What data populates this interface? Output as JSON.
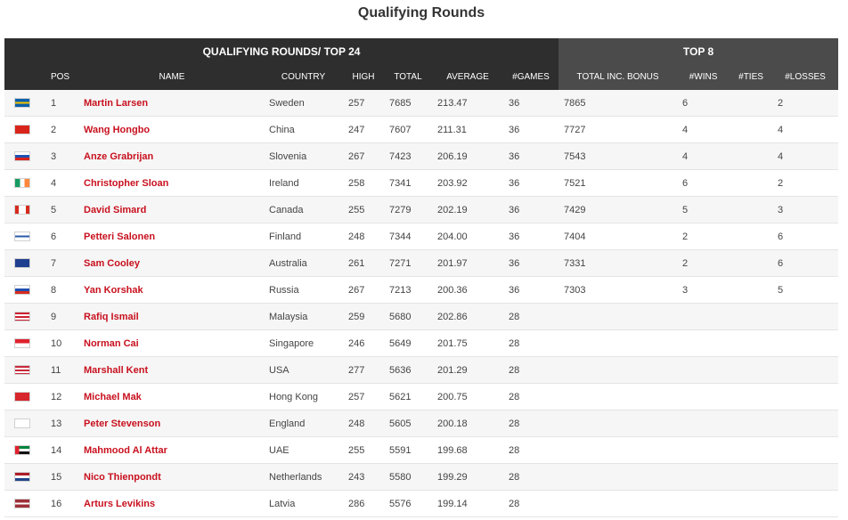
{
  "page_title": "Qualifying Rounds",
  "group_headers": {
    "qualifying": "QUALIFYING ROUNDS/ TOP 24",
    "top8": "TOP 8"
  },
  "columns": {
    "pos": "POS",
    "name": "NAME",
    "country": "COUNTRY",
    "high": "HIGH",
    "total": "TOTAL",
    "average": "AVERAGE",
    "games": "#GAMES",
    "total_inc_bonus": "TOTAL INC. BONUS",
    "wins": "#WINS",
    "ties": "#TIES",
    "losses": "#LOSSES"
  },
  "rows": [
    {
      "flag": "sweden",
      "pos": "1",
      "name": "Martin Larsen",
      "country": "Sweden",
      "high": "257",
      "total": "7685",
      "average": "213.47",
      "games": "36",
      "bonus": "7865",
      "wins": "6",
      "ties": "",
      "losses": "2"
    },
    {
      "flag": "china",
      "pos": "2",
      "name": "Wang Hongbo",
      "country": "China",
      "high": "247",
      "total": "7607",
      "average": "211.31",
      "games": "36",
      "bonus": "7727",
      "wins": "4",
      "ties": "",
      "losses": "4"
    },
    {
      "flag": "slovenia",
      "pos": "3",
      "name": "Anze Grabrijan",
      "country": "Slovenia",
      "high": "267",
      "total": "7423",
      "average": "206.19",
      "games": "36",
      "bonus": "7543",
      "wins": "4",
      "ties": "",
      "losses": "4"
    },
    {
      "flag": "ireland",
      "pos": "4",
      "name": "Christopher Sloan",
      "country": "Ireland",
      "high": "258",
      "total": "7341",
      "average": "203.92",
      "games": "36",
      "bonus": "7521",
      "wins": "6",
      "ties": "",
      "losses": "2"
    },
    {
      "flag": "canada",
      "pos": "5",
      "name": "David Simard",
      "country": "Canada",
      "high": "255",
      "total": "7279",
      "average": "202.19",
      "games": "36",
      "bonus": "7429",
      "wins": "5",
      "ties": "",
      "losses": "3"
    },
    {
      "flag": "finland",
      "pos": "6",
      "name": "Petteri Salonen",
      "country": "Finland",
      "high": "248",
      "total": "7344",
      "average": "204.00",
      "games": "36",
      "bonus": "7404",
      "wins": "2",
      "ties": "",
      "losses": "6"
    },
    {
      "flag": "australia",
      "pos": "7",
      "name": "Sam Cooley",
      "country": "Australia",
      "high": "261",
      "total": "7271",
      "average": "201.97",
      "games": "36",
      "bonus": "7331",
      "wins": "2",
      "ties": "",
      "losses": "6"
    },
    {
      "flag": "russia",
      "pos": "8",
      "name": "Yan Korshak",
      "country": "Russia",
      "high": "267",
      "total": "7213",
      "average": "200.36",
      "games": "36",
      "bonus": "7303",
      "wins": "3",
      "ties": "",
      "losses": "5"
    },
    {
      "flag": "malaysia",
      "pos": "9",
      "name": "Rafiq Ismail",
      "country": "Malaysia",
      "high": "259",
      "total": "5680",
      "average": "202.86",
      "games": "28",
      "bonus": "",
      "wins": "",
      "ties": "",
      "losses": ""
    },
    {
      "flag": "singapore",
      "pos": "10",
      "name": "Norman Cai",
      "country": "Singapore",
      "high": "246",
      "total": "5649",
      "average": "201.75",
      "games": "28",
      "bonus": "",
      "wins": "",
      "ties": "",
      "losses": ""
    },
    {
      "flag": "usa",
      "pos": "11",
      "name": "Marshall Kent",
      "country": "USA",
      "high": "277",
      "total": "5636",
      "average": "201.29",
      "games": "28",
      "bonus": "",
      "wins": "",
      "ties": "",
      "losses": ""
    },
    {
      "flag": "hongkong",
      "pos": "12",
      "name": "Michael Mak",
      "country": "Hong Kong",
      "high": "257",
      "total": "5621",
      "average": "200.75",
      "games": "28",
      "bonus": "",
      "wins": "",
      "ties": "",
      "losses": ""
    },
    {
      "flag": "england",
      "pos": "13",
      "name": "Peter Stevenson",
      "country": "England",
      "high": "248",
      "total": "5605",
      "average": "200.18",
      "games": "28",
      "bonus": "",
      "wins": "",
      "ties": "",
      "losses": ""
    },
    {
      "flag": "uae",
      "pos": "14",
      "name": "Mahmood Al Attar",
      "country": "UAE",
      "high": "255",
      "total": "5591",
      "average": "199.68",
      "games": "28",
      "bonus": "",
      "wins": "",
      "ties": "",
      "losses": ""
    },
    {
      "flag": "netherlands",
      "pos": "15",
      "name": "Nico Thienpondt",
      "country": "Netherlands",
      "high": "243",
      "total": "5580",
      "average": "199.29",
      "games": "28",
      "bonus": "",
      "wins": "",
      "ties": "",
      "losses": ""
    },
    {
      "flag": "latvia",
      "pos": "16",
      "name": "Arturs Levikins",
      "country": "Latvia",
      "high": "286",
      "total": "5576",
      "average": "199.14",
      "games": "28",
      "bonus": "",
      "wins": "",
      "ties": "",
      "losses": ""
    }
  ]
}
